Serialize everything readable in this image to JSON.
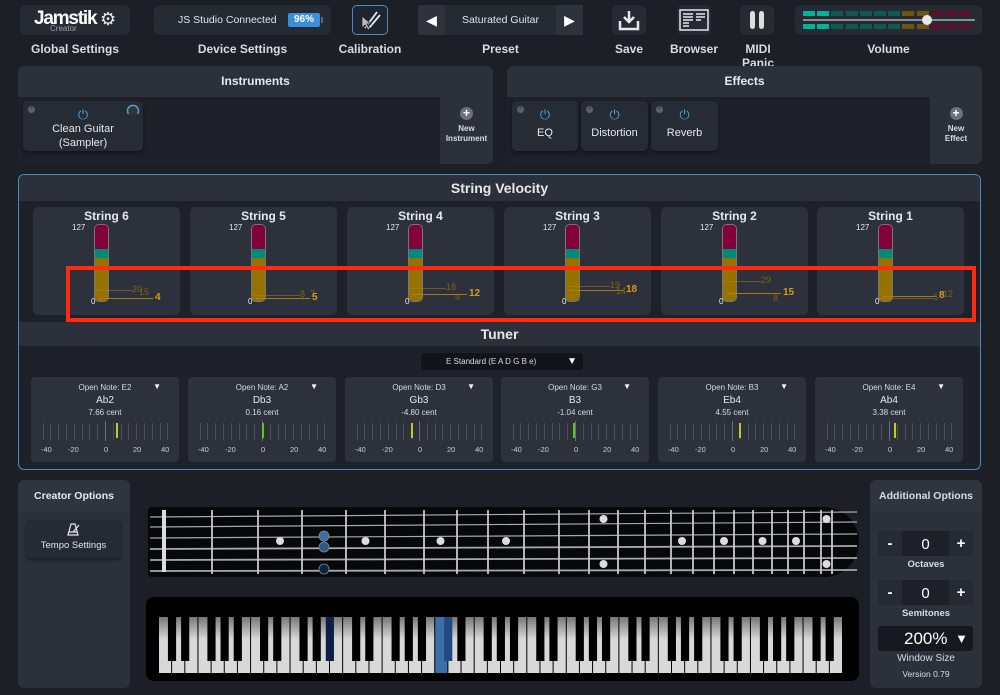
{
  "toolbar": {
    "logo": {
      "brand": "Jamstik",
      "sub": "Creator"
    },
    "global_settings_label": "Global Settings",
    "device": {
      "status": "JS Studio Connected",
      "battery": "96%",
      "label": "Device Settings"
    },
    "calibration_label": "Calibration",
    "preset": {
      "name": "Saturated Guitar",
      "label": "Preset"
    },
    "save_label": "Save",
    "browser_label": "Browser",
    "midi_panic_label": "MIDI Panic",
    "volume": {
      "label": "Volume",
      "level": 0.72,
      "meter_lit_segments": 2,
      "meter_total_segments": 12
    }
  },
  "instruments": {
    "title": "Instruments",
    "items": [
      {
        "name": "Clean Guitar (Sampler)"
      }
    ],
    "new_label": "New Instrument"
  },
  "effects": {
    "title": "Effects",
    "items": [
      {
        "name": "EQ"
      },
      {
        "name": "Distortion"
      },
      {
        "name": "Reverb"
      }
    ],
    "new_label": "New Effect"
  },
  "string_velocity": {
    "title": "String Velocity",
    "max_label": "127",
    "min_label": "0",
    "strings": [
      {
        "name": "String 6",
        "current": "4",
        "history": [
          "20",
          "15"
        ]
      },
      {
        "name": "String 5",
        "current": "5",
        "history": [
          "8",
          "7"
        ]
      },
      {
        "name": "String 4",
        "current": "12",
        "history": [
          "18",
          "4"
        ]
      },
      {
        "name": "String 3",
        "current": "18",
        "history": [
          "19",
          "14"
        ]
      },
      {
        "name": "String 2",
        "current": "15",
        "history": [
          "29",
          "8"
        ]
      },
      {
        "name": "String 1",
        "current": "8",
        "history": [
          "6",
          "12"
        ]
      }
    ]
  },
  "tuner": {
    "title": "Tuner",
    "tuning": "E Standard (E A D G B e)",
    "scale_labels": [
      "-40",
      "-20",
      "0",
      "20",
      "40"
    ],
    "strings": [
      {
        "open_note": "Open Note: E2",
        "note": "Ab2",
        "cent_label": "7.66 cent",
        "cents": 7.66,
        "color": "#c8c820"
      },
      {
        "open_note": "Open Note: A2",
        "note": "Db3",
        "cent_label": "0.16 cent",
        "cents": 0.16,
        "color": "#5cc81e"
      },
      {
        "open_note": "Open Note: D3",
        "note": "Gb3",
        "cent_label": "-4.80 cent",
        "cents": -4.8,
        "color": "#c8c820"
      },
      {
        "open_note": "Open Note: G3",
        "note": "B3",
        "cent_label": "-1.04 cent",
        "cents": -1.04,
        "color": "#5cc81e"
      },
      {
        "open_note": "Open Note: B3",
        "note": "Eb4",
        "cent_label": "4.55 cent",
        "cents": 4.55,
        "color": "#c8c820"
      },
      {
        "open_note": "Open Note: E4",
        "note": "Ab4",
        "cent_label": "3.38 cent",
        "cents": 3.38,
        "color": "#c8c820"
      }
    ]
  },
  "creator_options": {
    "title": "Creator Options",
    "tempo_label": "Tempo Settings"
  },
  "fretboard": {
    "frets": 24,
    "active_notes": [
      {
        "string": 3,
        "fret": 4,
        "color": "#3a6fa8"
      },
      {
        "string": 4,
        "fret": 4,
        "color": "#2c5a90"
      },
      {
        "string": 6,
        "fret": 4,
        "color": "#0e2248"
      }
    ]
  },
  "keyboard": {
    "active_keys": [
      {
        "type": "black",
        "index": 9,
        "color": "#0c1f44"
      },
      {
        "type": "black",
        "index": 15,
        "color": "#234a80"
      },
      {
        "type": "white",
        "index": 21,
        "color": "#3a6fa8"
      }
    ]
  },
  "additional_options": {
    "title": "Additional Options",
    "octaves": {
      "value": "0",
      "label": "Octaves"
    },
    "semitones": {
      "value": "0",
      "label": "Semitones"
    },
    "minus": "-",
    "plus": "+",
    "window_size": {
      "value": "200%",
      "label": "Window Size"
    },
    "version": "Version 0.79"
  }
}
